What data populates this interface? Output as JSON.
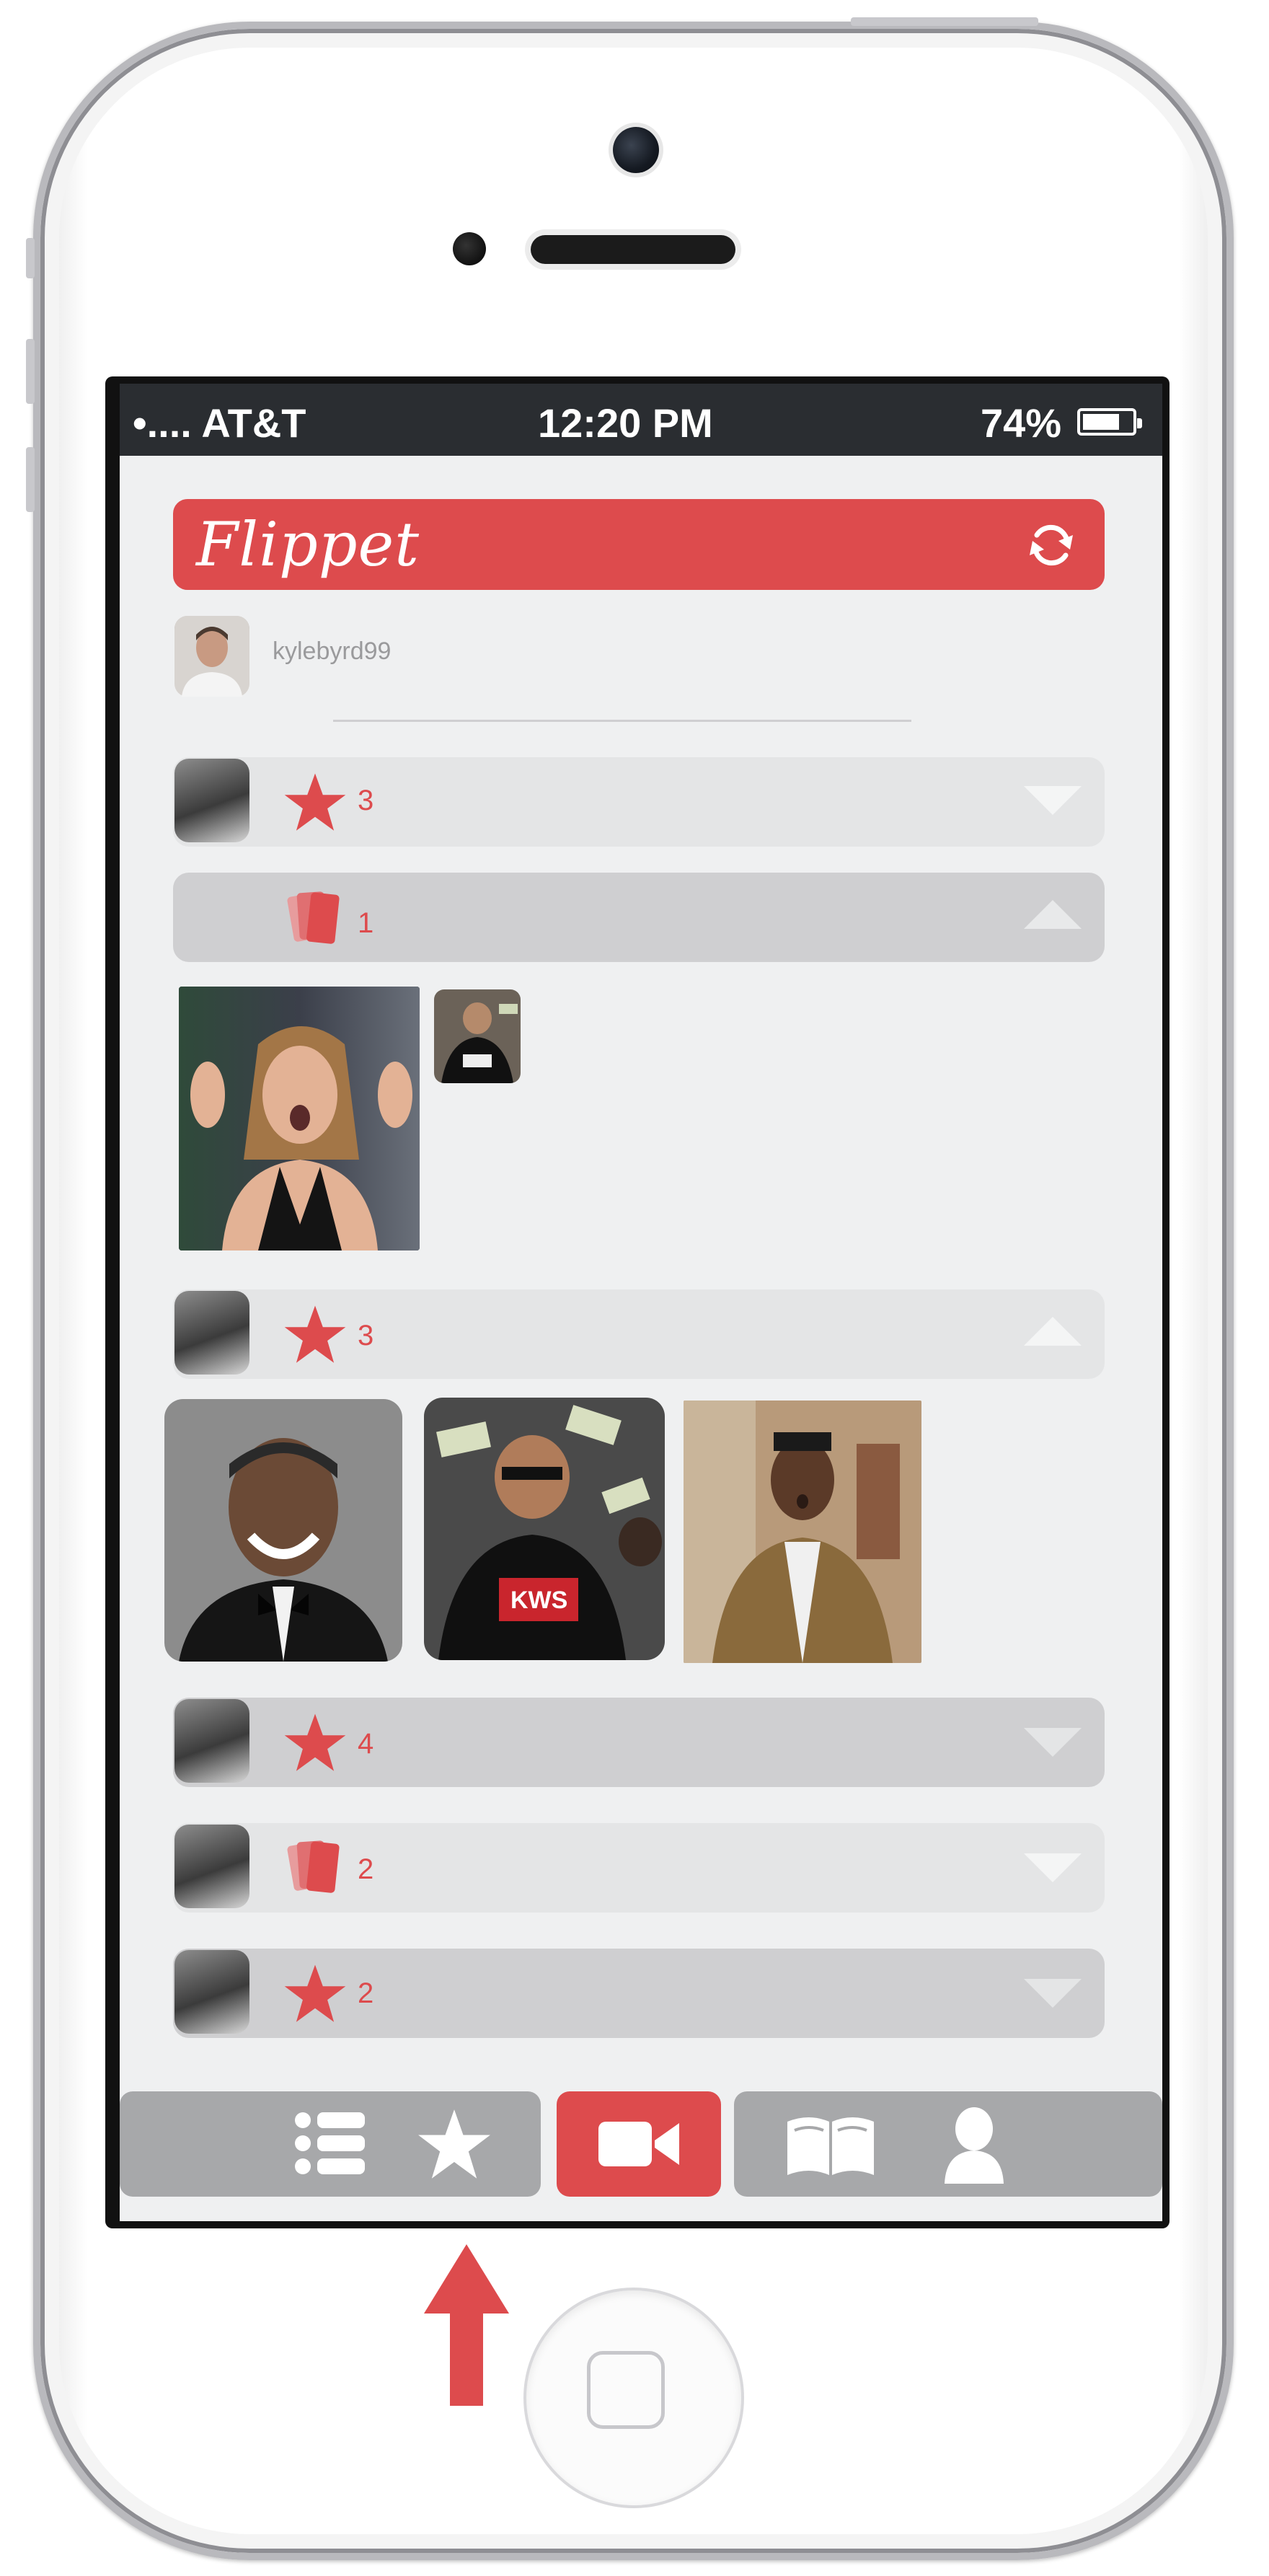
{
  "status_bar": {
    "carrier": "•.... AT&T",
    "time": "12:20 PM",
    "battery_percent": "74%",
    "battery_level": 0.74
  },
  "header": {
    "app_name": "Flippet",
    "refresh_icon": "refresh-icon"
  },
  "profile": {
    "username": "kylebyrd99"
  },
  "rows": [
    {
      "icon": "star-icon",
      "count": "3",
      "expanded": false
    },
    {
      "icon": "cards-icon",
      "count": "1",
      "expanded": true
    },
    {
      "icon": "star-icon",
      "count": "3",
      "expanded": true
    },
    {
      "icon": "star-icon",
      "count": "4",
      "expanded": false
    },
    {
      "icon": "cards-icon",
      "count": "2",
      "expanded": false
    },
    {
      "icon": "star-icon",
      "count": "2",
      "expanded": false
    }
  ],
  "tab_bar": {
    "tabs": [
      {
        "name": "list",
        "icon": "list-icon"
      },
      {
        "name": "favorites",
        "icon": "star-icon"
      },
      {
        "name": "record",
        "icon": "video-camera-icon"
      },
      {
        "name": "library",
        "icon": "book-icon"
      },
      {
        "name": "profile",
        "icon": "user-icon"
      }
    ],
    "active": "record"
  },
  "colors": {
    "accent": "#dd4b4d",
    "status_bar": "#2a2d31",
    "background": "#eff0f1",
    "tab_bar": "#a7a8aa"
  }
}
